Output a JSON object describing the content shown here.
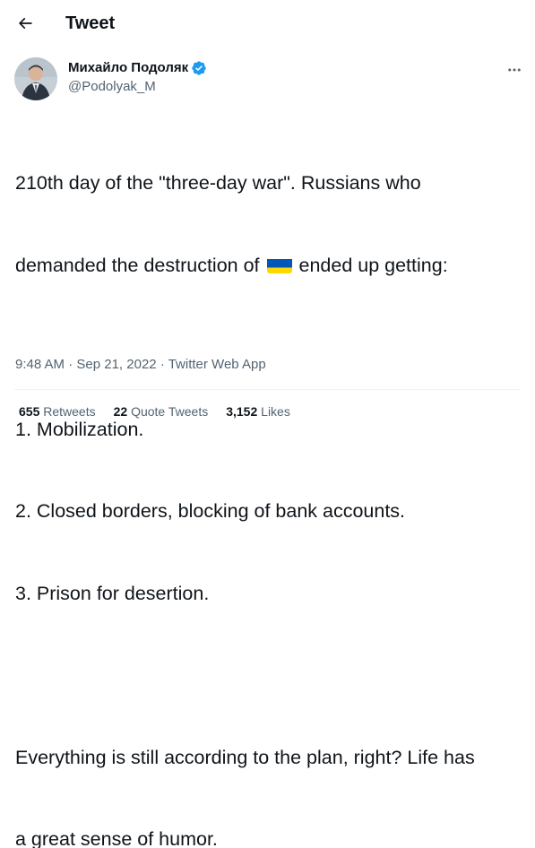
{
  "header": {
    "title": "Tweet",
    "back_icon": "arrow-left-icon"
  },
  "author": {
    "name": "Михайло Подоляк",
    "handle": "@Podolyak_M",
    "verified_icon": "verified-badge-icon",
    "verified_color": "#1d9bf0"
  },
  "tweet": {
    "line1": "210th day of the \"three-day war\". Russians who",
    "line2_before_flag": "demanded the destruction of",
    "flag_icon": "ukraine-flag-icon",
    "line2_after_flag": "ended up getting:",
    "list": [
      "1. Mobilization.",
      "2. Closed borders, blocking of bank accounts.",
      "3. Prison for desertion."
    ],
    "closing_line1": "Everything is still according to the plan, right? Life has",
    "closing_line2": "a great sense of humor."
  },
  "meta": {
    "time": "9:48 AM",
    "date": "Sep 21, 2022",
    "source": "Twitter Web App",
    "separator": "·"
  },
  "stats": {
    "retweets_count": "655",
    "retweets_label": "Retweets",
    "quotes_count": "22",
    "quotes_label": "Quote Tweets",
    "likes_count": "3,152",
    "likes_label": "Likes"
  },
  "colors": {
    "text": "#0f1419",
    "secondary": "#536471",
    "divider": "#eff3f4",
    "flag_blue": "#0057b7",
    "flag_yellow": "#ffd700"
  }
}
